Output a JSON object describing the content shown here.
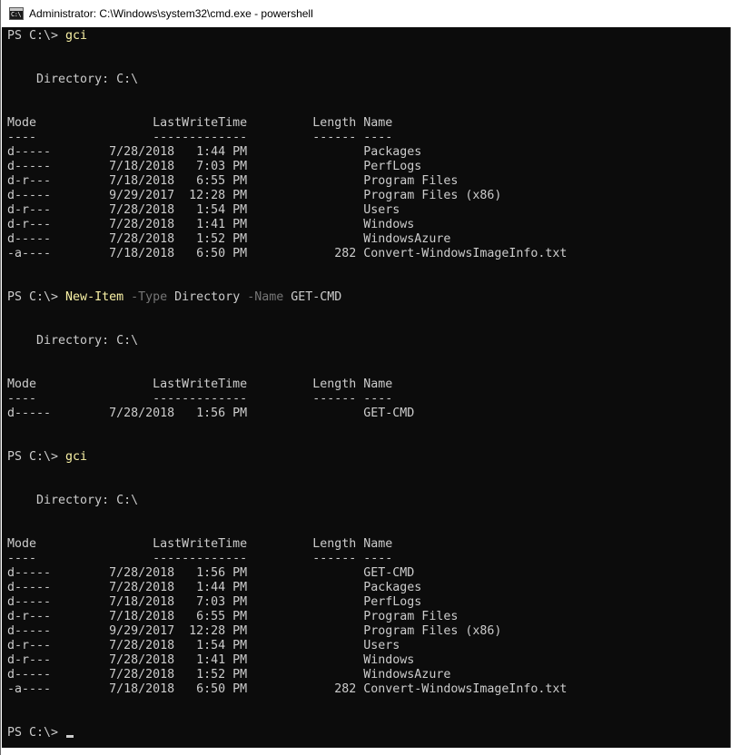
{
  "window": {
    "title": "Administrator: C:\\Windows\\system32\\cmd.exe - powershell",
    "icon": "cmd-console-icon"
  },
  "colors": {
    "console_background": "#0c0c0c",
    "console_text": "#cccccc",
    "command_text": "#f9f1a5",
    "parameter_text": "#767676"
  },
  "console": {
    "lines": [
      "PS C:\\> ",
      "",
      "",
      "    Directory: C:\\",
      "",
      "",
      "Mode                LastWriteTime         Length Name",
      "----                -------------         ------ ----",
      "d-----        7/28/2018   1:44 PM                Packages",
      "d-----        7/18/2018   7:03 PM                PerfLogs",
      "d-r---        7/18/2018   6:55 PM                Program Files",
      "d-----        9/29/2017  12:28 PM                Program Files (x86)",
      "d-r---        7/28/2018   1:54 PM                Users",
      "d-r---        7/28/2018   1:41 PM                Windows",
      "d-----        7/28/2018   1:52 PM                WindowsAzure",
      "-a----        7/18/2018   6:50 PM            282 Convert-WindowsImageInfo.txt",
      "",
      "",
      "PS C:\\> ",
      "",
      "",
      "    Directory: C:\\",
      "",
      "",
      "Mode                LastWriteTime         Length Name",
      "----                -------------         ------ ----",
      "d-----        7/28/2018   1:56 PM                GET-CMD",
      "",
      "",
      "PS C:\\> ",
      "",
      "",
      "    Directory: C:\\",
      "",
      "",
      "Mode                LastWriteTime         Length Name",
      "----                -------------         ------ ----",
      "d-----        7/28/2018   1:56 PM                GET-CMD",
      "d-----        7/28/2018   1:44 PM                Packages",
      "d-----        7/18/2018   7:03 PM                PerfLogs",
      "d-r---        7/18/2018   6:55 PM                Program Files",
      "d-----        9/29/2017  12:28 PM                Program Files (x86)",
      "d-r---        7/28/2018   1:54 PM                Users",
      "d-r---        7/28/2018   1:41 PM                Windows",
      "d-----        7/28/2018   1:52 PM                WindowsAzure",
      "-a----        7/18/2018   6:50 PM            282 Convert-WindowsImageInfo.txt",
      "",
      "",
      "PS C:\\> "
    ],
    "commands": {
      "first": "gci",
      "second_cmdlet": "New-Item",
      "second_param1": " -Type",
      "second_arg1": " Directory",
      "second_param2": " -Name",
      "second_arg2": " GET-CMD",
      "third": "gci"
    }
  }
}
